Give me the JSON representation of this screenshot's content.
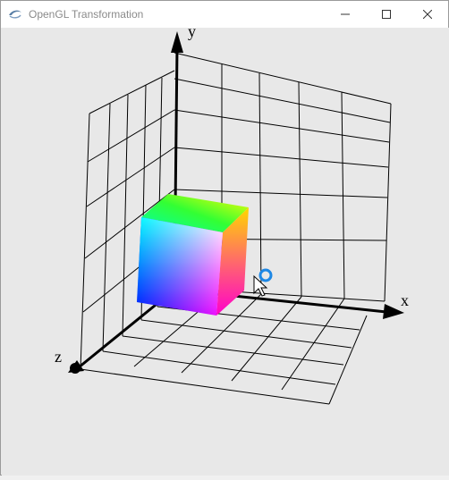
{
  "window": {
    "title": "OpenGL Transformation",
    "icon": "opengl-app-icon",
    "controls": [
      "minimize",
      "maximize",
      "close"
    ]
  },
  "scene": {
    "axes": {
      "x_label": "x",
      "y_label": "y",
      "z_label": "z"
    },
    "object": "rgb-color-cube",
    "grid_planes": [
      "xy-back",
      "yz-left",
      "xz-floor"
    ],
    "cursor": "busy-pointer"
  },
  "colors": {
    "titlebar_bg": "#ffffff",
    "canvas_bg": "#e8e8e8",
    "grid": "#000000",
    "busy_ring": "#1e88e5"
  }
}
